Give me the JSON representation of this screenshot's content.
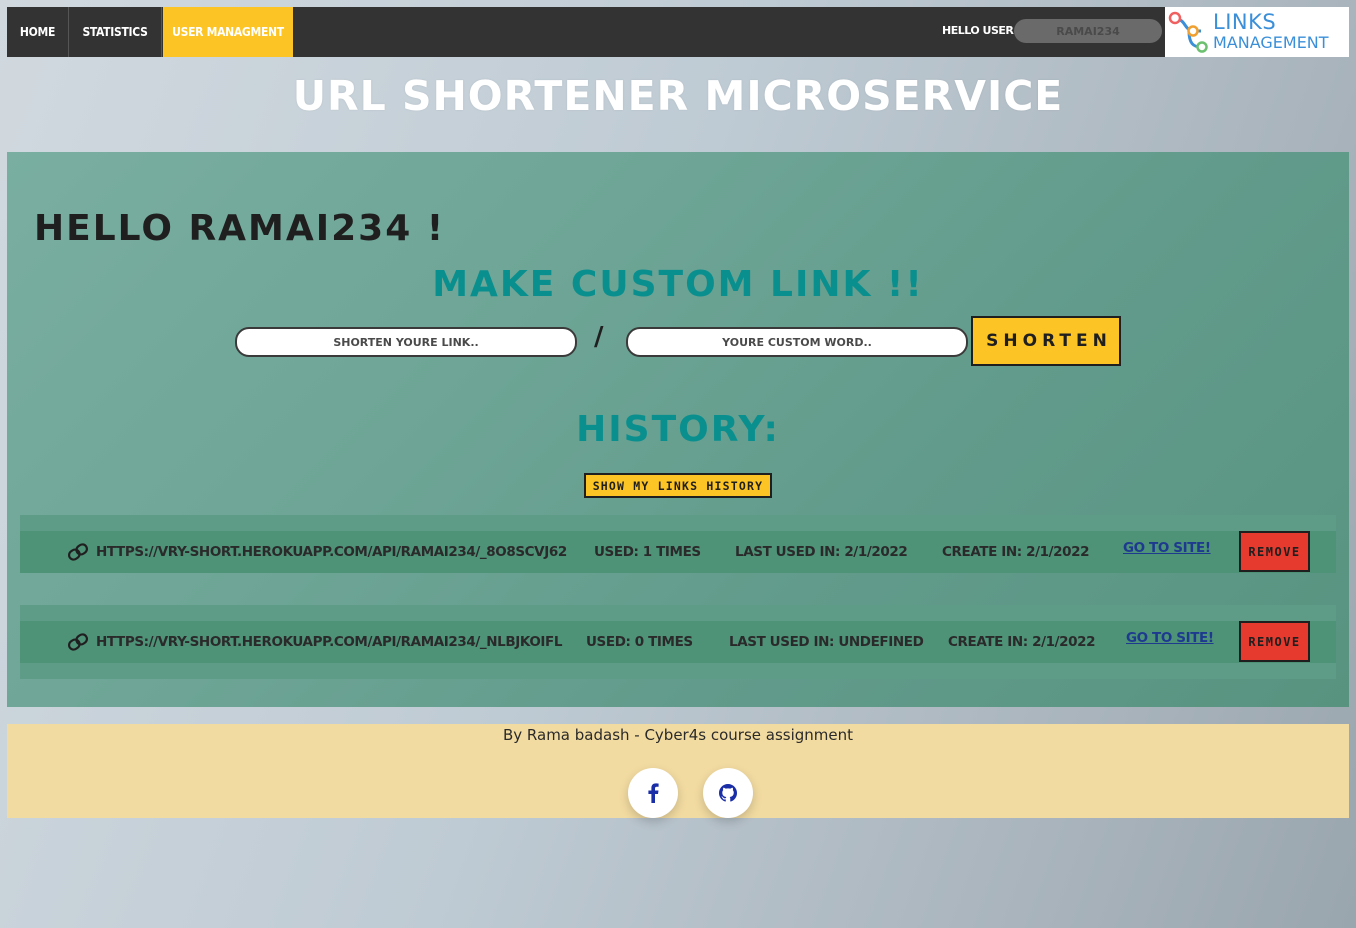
{
  "nav": {
    "items": [
      {
        "label": "Home"
      },
      {
        "label": "Statistics"
      },
      {
        "label": "User managment"
      }
    ],
    "hello_label": "Hello user:",
    "username_value": "ramai234",
    "logo": {
      "line1": "Links",
      "line2": "Management"
    }
  },
  "page": {
    "title": "URL Shortener microservice"
  },
  "main": {
    "greeting": "Hello ramai234 !",
    "custom_title": "Make custom link !!",
    "url_placeholder": "SHORTEN YOURE LINK..",
    "word_placeholder": "YOURE CUSTOM WORD..",
    "slash": "/",
    "shorten_label": "Shorten",
    "history_title": "History:",
    "history_button": "Show my links history",
    "links": [
      {
        "url": "https://vry-short.herokuapp.com/api/ramai234/_8O8SCvJ62",
        "used": "used: 1 times",
        "last_used": "Last used in: 2/1/2022",
        "created": "create in: 2/1/2022",
        "goto": "go to site!",
        "remove": "Remove"
      },
      {
        "url": "https://vry-short.herokuapp.com/api/ramai234/_nLbJkOIfl",
        "used": "used: 0 times",
        "last_used": "Last used in: undefined",
        "created": "create in: 2/1/2022",
        "goto": "go to site!",
        "remove": "Remove"
      }
    ]
  },
  "footer": {
    "credit": "By Rama badash - Cyber4s course assignment",
    "social": [
      {
        "icon": "facebook-icon"
      },
      {
        "icon": "github-icon"
      }
    ]
  },
  "colors": {
    "nav_bg": "#333333",
    "accent_yellow": "#fdc425",
    "teal_heading": "#0a8f8f",
    "remove_red": "#e63a2e",
    "footer_bg": "#f2dba1",
    "logo_blue": "#3b8fd9"
  }
}
